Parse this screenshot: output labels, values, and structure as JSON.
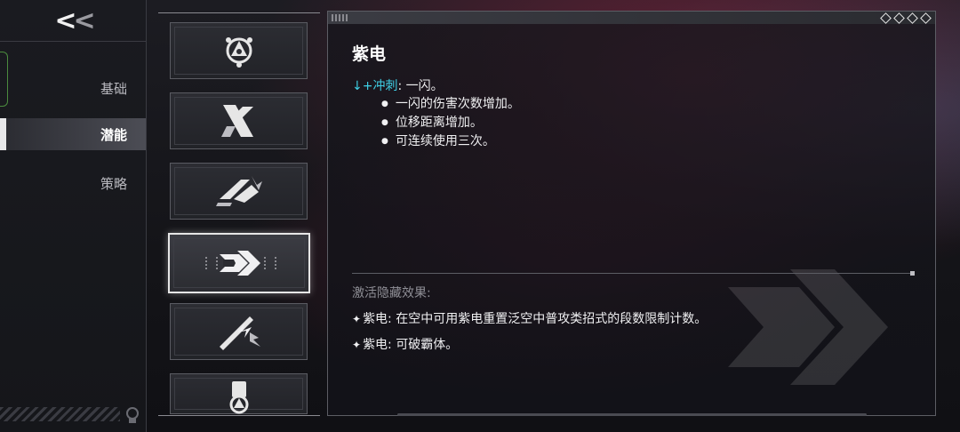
{
  "nav": {
    "back_glyph_main": "<",
    "back_glyph_dim": "<",
    "items": [
      {
        "label": "基础",
        "active": false
      },
      {
        "label": "潜能",
        "active": true
      },
      {
        "label": "策略",
        "active": false
      }
    ]
  },
  "cards": [
    {
      "icon": "triangle-emblem-icon",
      "selected": false
    },
    {
      "icon": "slash-emblem-icon",
      "selected": false
    },
    {
      "icon": "dash-burst-icon",
      "selected": false
    },
    {
      "icon": "dash-arrow-icon",
      "selected": true
    },
    {
      "icon": "lightning-slash-icon",
      "selected": false
    },
    {
      "icon": "shield-emblem-icon",
      "selected": false
    }
  ],
  "detail": {
    "title": "紫电",
    "input_arrow": "↓",
    "input_action": "+冲刺",
    "input_sep": ":",
    "input_desc": " 一闪。",
    "bullets": [
      "一闪的伤害次数增加。",
      "位移距离增加。",
      "可连续使用三次。"
    ],
    "hidden_title": "激活隐藏效果:",
    "effects": [
      "紫电: 在空中可用紫电重置泛空中普攻类招式的段数限制计数。",
      "紫电: 可破霸体。"
    ]
  },
  "colors": {
    "accent_cyan": "#3fd0e6",
    "selected_border": "#e6e6e6"
  }
}
